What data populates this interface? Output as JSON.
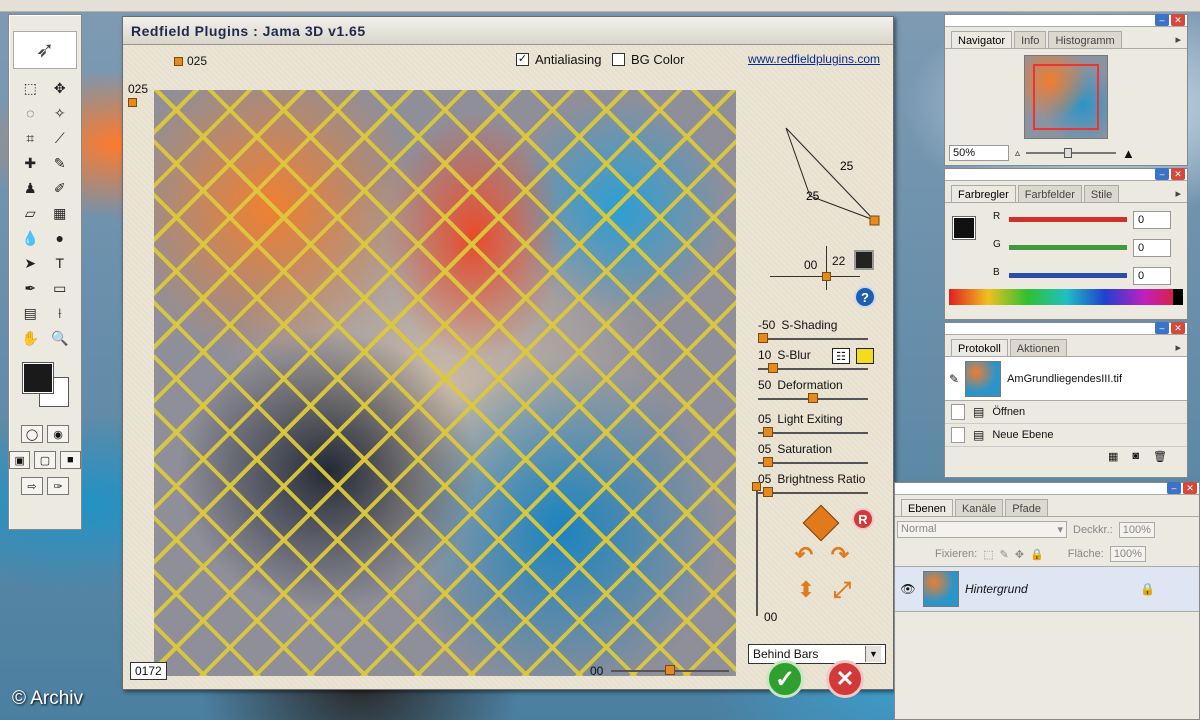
{
  "dialog": {
    "title": "Redfield Plugins : Jama 3D  v1.65",
    "antialiasing_label": "Antialiasing",
    "antialiasing_checked": true,
    "bg_color_label": "BG Color",
    "bg_color_checked": false,
    "url": "www.redfieldplugins.com",
    "top_counter": "025",
    "left_counter": "025",
    "bottom_counter": "0172",
    "bottom_slider_value": "00",
    "angle_value_a": "25",
    "angle_value_b": "25",
    "depth_value_left": "00",
    "depth_value_right": "22",
    "sliders": [
      {
        "value": "-50",
        "label": "S-Shading",
        "position": 0.0
      },
      {
        "value": "10",
        "label": "S-Blur",
        "position": 0.1
      },
      {
        "value": "50",
        "label": "Deformation",
        "position": 0.5
      },
      {
        "value": "05",
        "label": "Light Exiting",
        "position": 0.05
      },
      {
        "value": "05",
        "label": "Saturation",
        "position": 0.05
      },
      {
        "value": "05",
        "label": "Brightness Ratio",
        "position": 0.05
      }
    ],
    "vertical_slider_value": "00",
    "mode_select": "Behind Bars",
    "help_symbol": "?",
    "reset_symbol": "R",
    "ok_symbol": "✓",
    "cancel_symbol": "✕"
  },
  "navigator_panel": {
    "tabs": [
      "Navigator",
      "Info",
      "Histogramm"
    ],
    "zoom": "50%"
  },
  "color_panel": {
    "tabs": [
      "Farbregler",
      "Farbfelder",
      "Stile"
    ],
    "r_label": "R",
    "g_label": "G",
    "b_label": "B",
    "r_value": "0",
    "g_value": "0",
    "b_value": "0",
    "colors": {
      "r_track": "#d0302a",
      "g_track": "#3f9a3f",
      "b_track": "#2a4ea8"
    }
  },
  "history_panel": {
    "tabs": [
      "Protokoll",
      "Aktionen"
    ],
    "snapshot": "AmGrundliegendesIII.tif",
    "items": [
      "Öffnen",
      "Neue Ebene"
    ]
  },
  "layers_panel": {
    "tabs": [
      "Ebenen",
      "Kanäle",
      "Pfade"
    ],
    "blend_mode": "Normal",
    "opacity_label": "Deckkr.:",
    "opacity_value": "100%",
    "lock_label": "Fixieren:",
    "fill_label": "Fläche:",
    "fill_value": "100%",
    "layer_name": "Hintergrund"
  },
  "credit": "© Archiv"
}
